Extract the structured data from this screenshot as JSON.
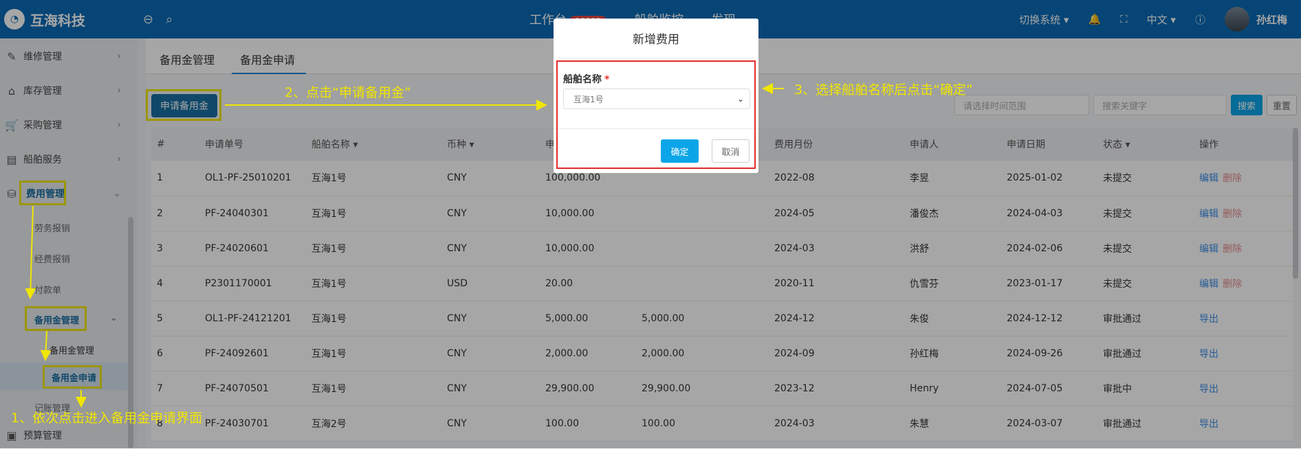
{
  "topbar": {
    "brand": "互海科技",
    "nav": [
      {
        "label": "工作台",
        "badge": "28832"
      },
      {
        "label": "船舶监控"
      },
      {
        "label": "发现"
      }
    ],
    "switch_system": "切换系统",
    "language": "中文",
    "user_name": "孙红梅"
  },
  "sidebar": {
    "items": [
      {
        "label": "维修管理",
        "icon": "wrench-icon"
      },
      {
        "label": "库存管理",
        "icon": "home-icon"
      },
      {
        "label": "采购管理",
        "icon": "cart-icon"
      },
      {
        "label": "船舶服务",
        "icon": "paint-roller-icon"
      },
      {
        "label": "费用管理",
        "icon": "database-icon"
      }
    ],
    "fee_sub": [
      "劳务报销",
      "经费报销",
      "付款单"
    ],
    "reserve_group": "备用金管理",
    "reserve_sub": [
      "备用金管理",
      "备用金申请"
    ],
    "after": "记账管理",
    "budget": "预算管理"
  },
  "tabs": [
    {
      "label": "备用金管理"
    },
    {
      "label": "备用金申请"
    }
  ],
  "toolbar": {
    "apply_button": "申请备用金",
    "time_range_placeholder": "请选择时间范围",
    "keyword_placeholder": "搜索关键字",
    "search_button": "搜索",
    "reset_button": "重置"
  },
  "table": {
    "columns": [
      "#",
      "申请单号",
      "船舶名称",
      "币种",
      "申",
      "",
      "费用月份",
      "申请人",
      "申请日期",
      "状态",
      "操作"
    ],
    "rows": [
      {
        "no": "1",
        "code": "OL1-PF-25010201",
        "ship": "互海1号",
        "currency": "CNY",
        "amount": "100,000.00",
        "approved": "",
        "month": "2022-08",
        "applicant": "李昱",
        "date": "2025-01-02",
        "status": "未提交",
        "actions": [
          "编辑",
          "删除"
        ]
      },
      {
        "no": "2",
        "code": "PF-24040301",
        "ship": "互海1号",
        "currency": "CNY",
        "amount": "10,000.00",
        "approved": "",
        "month": "2024-05",
        "applicant": "潘俊杰",
        "date": "2024-04-03",
        "status": "未提交",
        "actions": [
          "编辑",
          "删除"
        ]
      },
      {
        "no": "3",
        "code": "PF-24020601",
        "ship": "互海1号",
        "currency": "CNY",
        "amount": "10,000.00",
        "approved": "",
        "month": "2024-03",
        "applicant": "洪舒",
        "date": "2024-02-06",
        "status": "未提交",
        "actions": [
          "编辑",
          "删除"
        ]
      },
      {
        "no": "4",
        "code": "P2301170001",
        "ship": "互海1号",
        "currency": "USD",
        "amount": "20.00",
        "approved": "",
        "month": "2020-11",
        "applicant": "仇雪芬",
        "date": "2023-01-17",
        "status": "未提交",
        "actions": [
          "编辑",
          "删除"
        ]
      },
      {
        "no": "5",
        "code": "OL1-PF-24121201",
        "ship": "互海1号",
        "currency": "CNY",
        "amount": "5,000.00",
        "approved": "5,000.00",
        "month": "2024-12",
        "applicant": "朱俊",
        "date": "2024-12-12",
        "status": "审批通过",
        "actions": [
          "导出"
        ]
      },
      {
        "no": "6",
        "code": "PF-24092601",
        "ship": "互海1号",
        "currency": "CNY",
        "amount": "2,000.00",
        "approved": "2,000.00",
        "month": "2024-09",
        "applicant": "孙红梅",
        "date": "2024-09-26",
        "status": "审批通过",
        "actions": [
          "导出"
        ]
      },
      {
        "no": "7",
        "code": "PF-24070501",
        "ship": "互海1号",
        "currency": "CNY",
        "amount": "29,900.00",
        "approved": "29,900.00",
        "month": "2023-12",
        "applicant": "Henry",
        "date": "2024-07-05",
        "status": "审批中",
        "actions": [
          "导出"
        ]
      },
      {
        "no": "8",
        "code": "PF-24030701",
        "ship": "互海2号",
        "currency": "CNY",
        "amount": "100.00",
        "approved": "100.00",
        "month": "2024-03",
        "applicant": "朱慧",
        "date": "2024-03-07",
        "status": "审批通过",
        "actions": [
          "导出"
        ]
      }
    ]
  },
  "modal": {
    "title": "新增费用",
    "field_label": "船舶名称",
    "required_mark": "*",
    "selected_ship": "互海1号",
    "ok_button": "确定",
    "cancel_button": "取消"
  },
  "annotations": {
    "step1": "1、依次点击进入备用金申请界面",
    "step2": "2、点击“申请备用金”",
    "step3": "3、选择船舶名称后点击“确定”"
  },
  "colors": {
    "topbar": "#0a6bb5",
    "primary": "#1a88d9",
    "highlight": "#f0e600",
    "red_box": "#e02b2b"
  }
}
